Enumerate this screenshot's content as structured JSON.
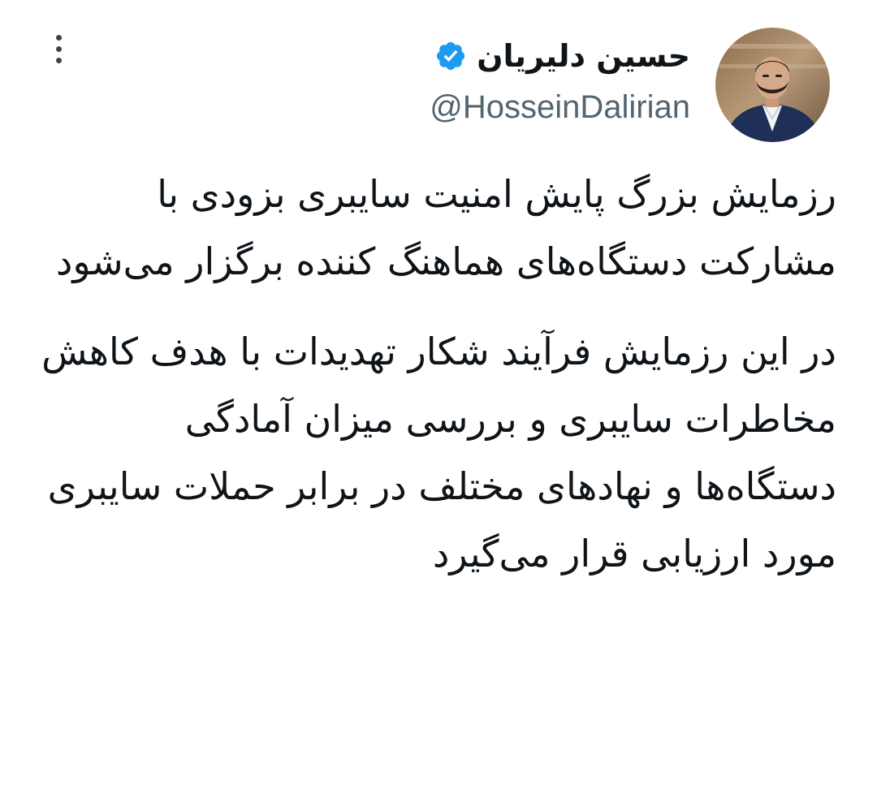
{
  "author": {
    "display_name": "حسین دلیریان",
    "handle": "@HosseinDalirian",
    "verified": true,
    "avatar_icon": "profile-photo",
    "verified_icon": "verified-badge-icon"
  },
  "menu": {
    "icon": "more-vertical-icon"
  },
  "tweet": {
    "paragraphs": [
      "رزمایش بزرگ پایش امنیت سایبری بزودی با مشارکت دستگاه‌های هماهنگ کننده برگزار می‌شود",
      "در این رزمایش فرآیند شکار تهدیدات با هدف کاهش مخاطرات سایبری و بررسی میزان آمادگی دستگاه‌ها و نهادهای مختلف در برابر حملات سایبری مورد ارزیابی قرار می‌گیرد"
    ]
  },
  "colors": {
    "background": "#ffffff",
    "text": "#0f1419",
    "handle": "#536471",
    "verified": "#1d9bf0",
    "menu_dots": "#3d4449"
  }
}
